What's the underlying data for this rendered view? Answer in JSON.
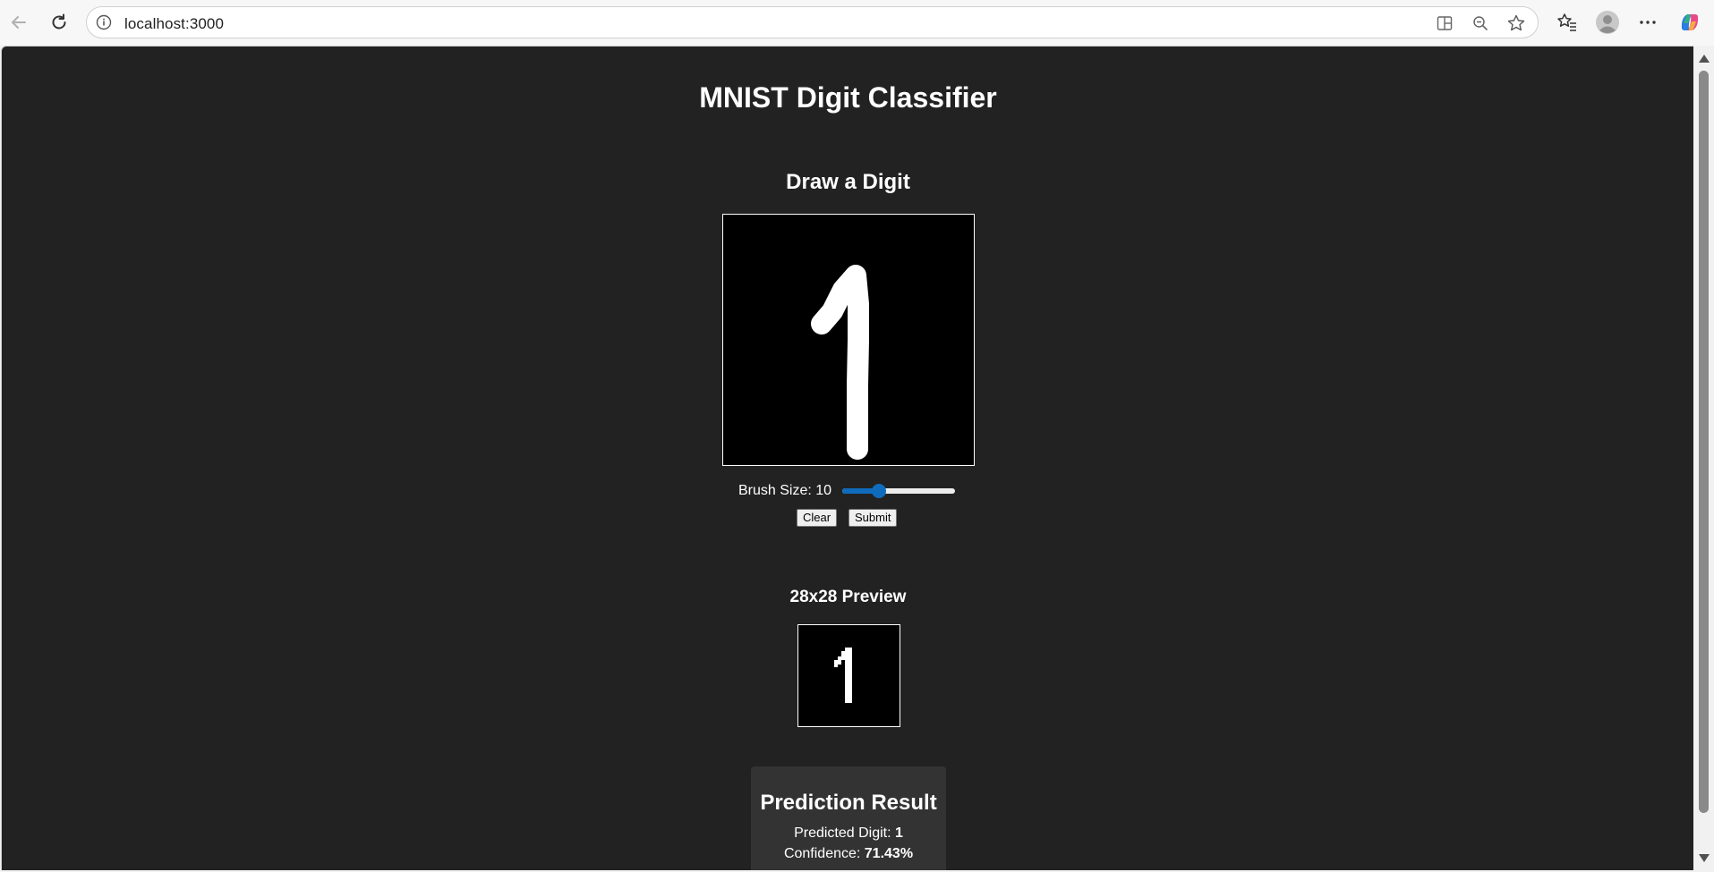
{
  "browser": {
    "url": "localhost:3000",
    "icons": {
      "back": "arrow-left-icon",
      "reload": "reload-icon",
      "info": "info-icon",
      "split": "split-screen-icon",
      "zoom": "zoom-out-icon",
      "favorite": "star-icon",
      "favorites_list": "favorites-icon",
      "profile": "avatar-icon",
      "more": "more-icon",
      "copilot": "copilot-icon"
    }
  },
  "page": {
    "title": "MNIST Digit Classifier",
    "draw_heading": "Draw a Digit",
    "brush_label": "Brush Size: 10",
    "brush_value": 10,
    "clear_label": "Clear",
    "submit_label": "Submit",
    "preview_heading": "28x28 Preview",
    "result": {
      "heading": "Prediction Result",
      "digit_label": "Predicted Digit: ",
      "digit_value": "1",
      "confidence_label": "Confidence: ",
      "confidence_value": "71.43%"
    }
  },
  "colors": {
    "page_bg": "#222222",
    "card_bg": "#333333",
    "accent": "#0f6cbd"
  }
}
